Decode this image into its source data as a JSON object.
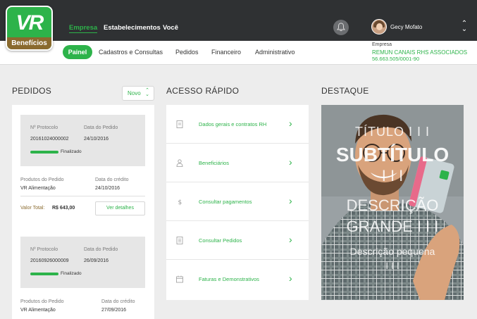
{
  "brand": {
    "logo_text": "VR",
    "logo_sub": "Benefícios",
    "green": "#2db34a",
    "gold": "#8a6a2e",
    "dark": "#2f3133"
  },
  "topnav": {
    "empresa": "Empresa",
    "estabelecimentos": "Estabelecimentos",
    "voce": "Você"
  },
  "user": {
    "name": "Gecy Mofato",
    "notification_icon": "bell-icon"
  },
  "subnav": {
    "painel": "Painel",
    "cadastros": "Cadastros e Consultas",
    "pedidos": "Pedidos",
    "financeiro": "Financeiro",
    "administrativo": "Administrativo"
  },
  "company": {
    "label": "Empresa",
    "name": "REMUN CANAIS RHS ASSOCIADOS",
    "cnpj": "56.663.505/0001-90"
  },
  "orders": {
    "title": "PEDIDOS",
    "new_button": "Novo",
    "protocol_label": "Nº Protocolo",
    "date_label": "Data do Pedido",
    "products_label": "Produtos do Pedido",
    "credit_label": "Data do crédito",
    "total_label": "Valor Total:",
    "details_button": "Ver detalhes",
    "items": [
      {
        "protocol": "20161024000002",
        "date": "24/10/2016",
        "status": "Finalizado",
        "product": "VR Alimentação",
        "credit_date": "24/10/2016",
        "total": "R$ 643,00"
      },
      {
        "protocol": "20160926000009",
        "date": "26/09/2016",
        "status": "Finalizado",
        "product": "VR Alimentação",
        "credit_date": "27/09/2016"
      }
    ]
  },
  "quick_access": {
    "title": "ACESSO RÁPIDO",
    "items": [
      {
        "label": "Dados gerais e contratos RH",
        "icon": "document-icon"
      },
      {
        "label": "Beneficiários",
        "icon": "person-icon"
      },
      {
        "label": "Consultar pagamentos",
        "icon": "dollar-icon"
      },
      {
        "label": "Consultar Pedidos",
        "icon": "list-icon"
      },
      {
        "label": "Faturas e Demonstrativos",
        "icon": "invoice-icon"
      }
    ]
  },
  "highlight": {
    "title": "DESTAQUE",
    "banner_title": "TÍTULO I I I",
    "banner_subtitle_1": "SUBTÍTULO",
    "banner_subtitle_2": "I I I",
    "banner_desc_1": "DESCRIÇÃO",
    "banner_desc_2": "GRANDE I I I",
    "banner_small": "Descrição pequena",
    "banner_small_2": "I I I"
  }
}
